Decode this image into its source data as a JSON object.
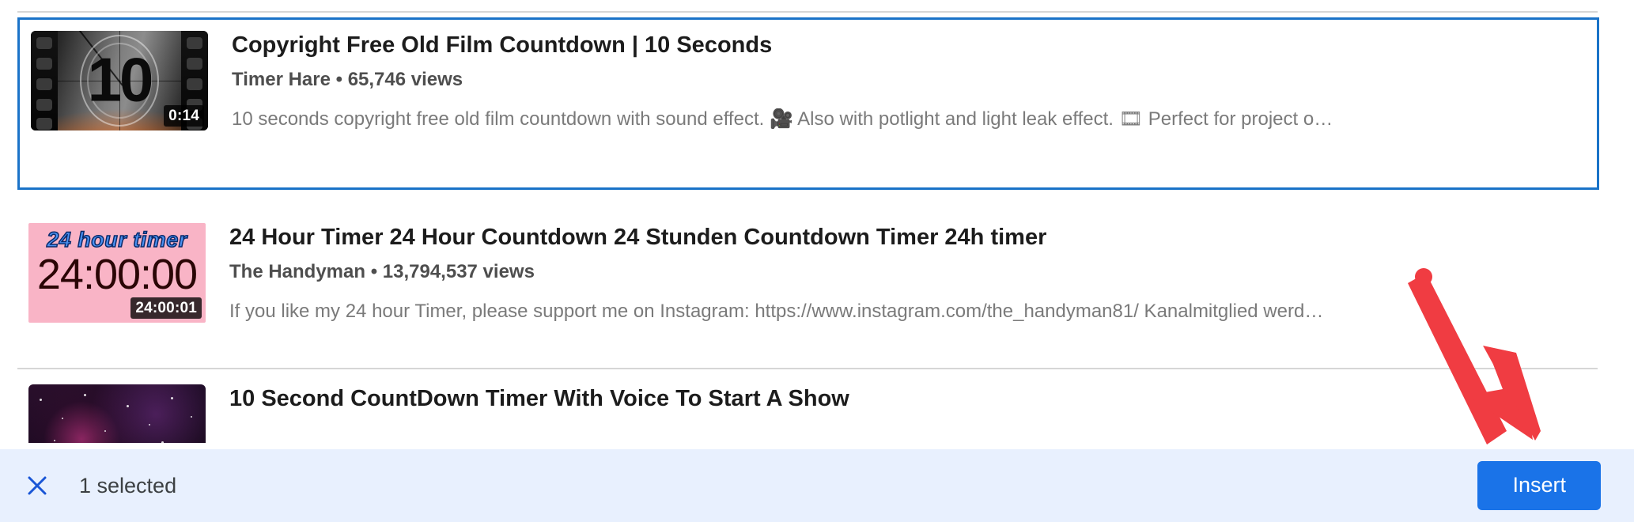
{
  "results": [
    {
      "title": "Copyright Free Old Film Countdown | 10 Seconds",
      "channel_and_views": "Timer Hare • 65,746 views",
      "description": "10 seconds copyright free old film countdown with sound effect. 🎥 Also with potlight and light leak effect. 🎞 Perfect for project o…",
      "duration": "0:14",
      "thumbnail_text": "10",
      "selected": true
    },
    {
      "title": "24 Hour Timer 24 Hour Countdown 24 Stunden Countdown Timer 24h timer",
      "channel_and_views": "The Handyman • 13,794,537 views",
      "description": "If you like my 24 hour Timer, please support me on Instagram: https://www.instagram.com/the_handyman81/ Kanalmitglied werd…",
      "duration": "24:00:01",
      "thumbnail_heading": "24 hour timer",
      "thumbnail_digits": "24:00:00",
      "selected": false
    },
    {
      "title": "10 Second CountDown Timer With Voice To Start A Show",
      "channel_and_views": "",
      "description": "",
      "duration": "",
      "selected": false
    }
  ],
  "action_bar": {
    "close_label": "close-icon",
    "selected_count": "1 selected",
    "insert_label": "Insert"
  },
  "colors": {
    "selection_border": "#1a73c8",
    "action_bar_bg": "#e8f0fe",
    "insert_button": "#1a73e8",
    "arrow": "#f03c42"
  }
}
